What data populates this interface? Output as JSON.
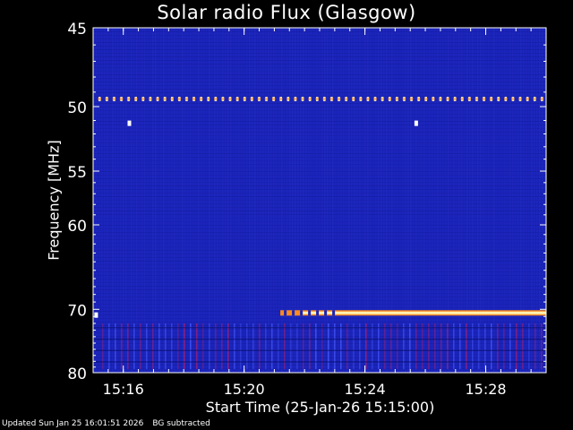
{
  "chart_data": {
    "type": "heatmap",
    "title": "Solar radio Flux (Glasgow)",
    "ylabel": "Frequency [MHz]",
    "xlabel": "Start Time (25-Jan-26 15:15:00)",
    "x_ticks": [
      "15:16",
      "15:20",
      "15:24",
      "15:28"
    ],
    "x_tick_minutes": [
      1,
      5,
      9,
      13
    ],
    "xlim_minutes": [
      0,
      15
    ],
    "y_ticks": [
      45,
      50,
      55,
      60,
      70,
      80
    ],
    "ylim": [
      45,
      80
    ],
    "y_scale": "reciprocal",
    "background_color": "#1a23b8",
    "features": [
      {
        "kind": "periodic-bursts",
        "frequency_mhz": 49.5,
        "start_minute": 0,
        "end_minute": 15
      },
      {
        "kind": "continuous-band",
        "frequency_mhz": 70.5,
        "start_minute": 6.2,
        "end_minute": 15
      },
      {
        "kind": "point",
        "frequency_mhz": 51.2,
        "minute": 1.2
      },
      {
        "kind": "point",
        "frequency_mhz": 51.2,
        "minute": 10.7
      },
      {
        "kind": "point",
        "frequency_mhz": 70.8,
        "minute": 0.1
      },
      {
        "kind": "vertical-striping",
        "frequency_from_mhz": 72,
        "frequency_to_mhz": 80,
        "start_minute": 0,
        "end_minute": 15
      }
    ]
  },
  "footer": {
    "updated": "Updated Sun Jan 25 16:01:51 2026",
    "note": "BG subtracted"
  }
}
